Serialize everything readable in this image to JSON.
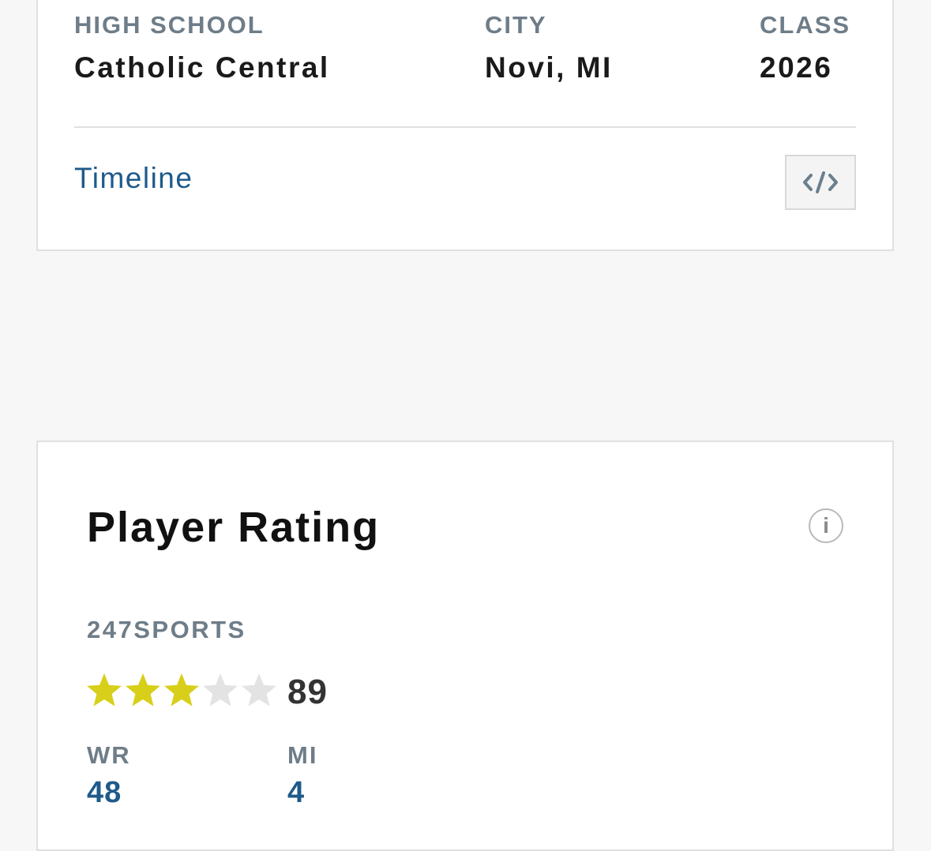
{
  "profile": {
    "high_school_label": "HIGH SCHOOL",
    "high_school": "Catholic Central",
    "city_label": "CITY",
    "city": "Novi, MI",
    "class_label": "CLASS",
    "class_year": "2026",
    "timeline_link": "Timeline",
    "embed_icon": "code-embed-icon"
  },
  "rating": {
    "title": "Player Rating",
    "info_icon": "info-icon",
    "info_glyph": "i",
    "source": "247SPORTS",
    "stars": 3,
    "stars_max": 5,
    "star_filled_color": "#d8cf1a",
    "star_empty_color": "#e3e3e3",
    "score": "89",
    "position_label": "WR",
    "position_rank": "48",
    "state_label": "MI",
    "state_rank": "4"
  }
}
